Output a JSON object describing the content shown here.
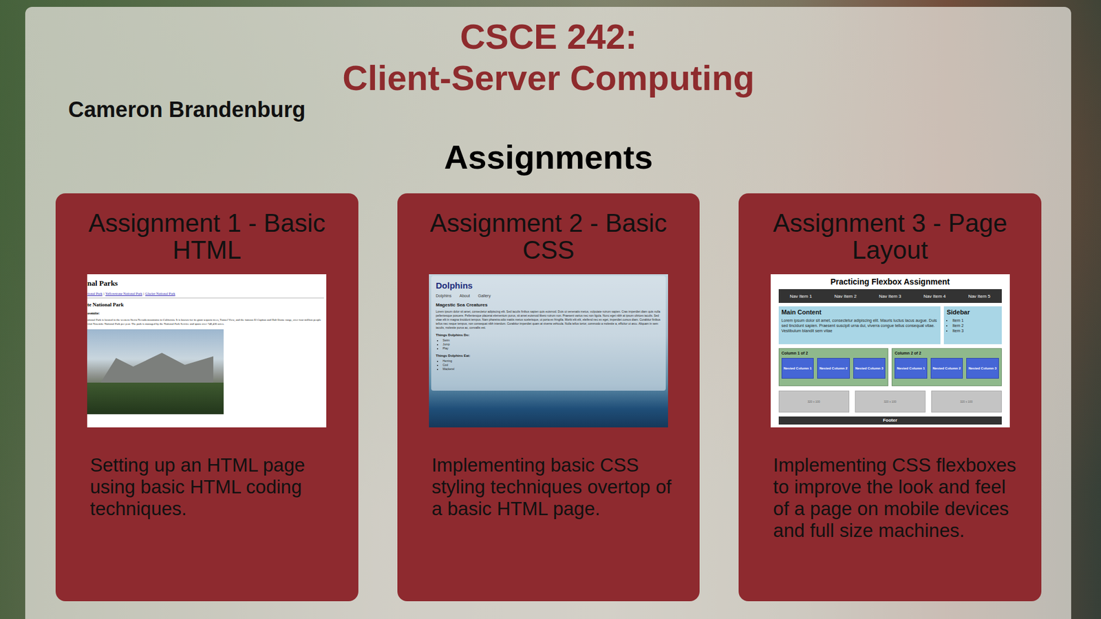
{
  "header": {
    "course_code": "CSCE 242:",
    "course_name": "Client-Server Computing",
    "author": "Cameron Brandenburg",
    "section_title": "Assignments"
  },
  "assignments": [
    {
      "title": "Assignment 1 - Basic HTML",
      "description": "Setting up an HTML page using basic HTML coding techniques.",
      "kind": "html",
      "preview": {
        "heading": "nal Parks",
        "links": [
          "tional Park",
          "Yellowstone National Park",
          "Glacier National Park"
        ],
        "separator": "|",
        "subheading": "te National Park",
        "label": "osemite:",
        "paragraph": "ational Park is located in the western Sierra Nevada mountains in California. It is known for its giant sequoia trees, Tunnel View, and the famous El Capitan and Half Dome range, over four million people visit Yosemite National Park per year. The park is managed by the National Park Service and spans over 748,436 acres."
      }
    },
    {
      "title": "Assignment 2 - Basic CSS",
      "description": "Implementing basic CSS styling techniques overtop of a basic HTML page.",
      "kind": "css",
      "preview": {
        "heading": "Dolphins",
        "nav": [
          "Dolphins",
          "About",
          "Gallery"
        ],
        "subheading": "Magestic Sea Creatures",
        "paragraph": "Lorem ipsum dolor sit amet, consectetur adipiscing elit. Sed iaculis finibus sapien quis euismod. Duis ut venenatis metus, vulputate rutrum sapien. Cras imperdiet diam quis nulla pellentesque posuere. Pellentesque placerat elementum purus, sit amet euismod libero rutrum non. Praesent varius nec non ligula. Nunc eget nibh at ipsum ultrices iaculis. Sed vitae elit in magna tincidunt tempus. Nam pharetra odio mattis metus scelerisque, ut porta ex fringilla. Morbi elit elit, eleifend nec ex eget, imperdiet cursus diam. Curabitur finibus tellus nec neque tempus, non consequat nibh interdum. Curabitur imperdiet quam at viverra vehicula. Nulla tellus tortor, commodo a molestie a, efficitur ut arcu. Aliquam in sem iaculis, molestie purus ac, convallis est.",
        "lists": [
          {
            "title": "Things Dolphins Do:",
            "items": [
              "Swim",
              "Jump",
              "Play"
            ]
          },
          {
            "title": "Things Dolphins Eat:",
            "items": [
              "Herring",
              "Cod",
              "Mackerel"
            ]
          }
        ]
      }
    },
    {
      "title": "Assignment 3 - Page Layout",
      "description": "Implementing CSS flexboxes to improve the look and feel of a page on mobile devices and full size machines.",
      "kind": "flexbox",
      "preview": {
        "heading": "Practicing Flexbox Assignment",
        "nav": [
          "Nav Item 1",
          "Nav Item 2",
          "Nav Item 3",
          "Nav Item 4",
          "Nav Item 5"
        ],
        "main": {
          "title": "Main Content",
          "text": "Lorem ipsum dolor sit amet, consectetur adipiscing elit. Mauris luctus lacus augue. Duis sed tincidunt sapien. Praesent suscipit urna dui, viverra congue tellus consequat vitae. Vestibulum blandit sem vitae"
        },
        "sidebar": {
          "title": "Sidebar",
          "items": [
            "Item 1",
            "Item 2",
            "Item 3"
          ]
        },
        "columns": [
          {
            "title": "Column 1 of 2",
            "nested": [
              "Nested Column 1",
              "Nested Column 2",
              "Nested Column 3"
            ]
          },
          {
            "title": "Column 2 of 2",
            "nested": [
              "Nested Column 1",
              "Nested Column 2",
              "Nested Column 3"
            ]
          }
        ],
        "boxes": [
          "320 x 100",
          "320 x 100",
          "320 x 100"
        ],
        "footer": "Footer"
      }
    }
  ]
}
